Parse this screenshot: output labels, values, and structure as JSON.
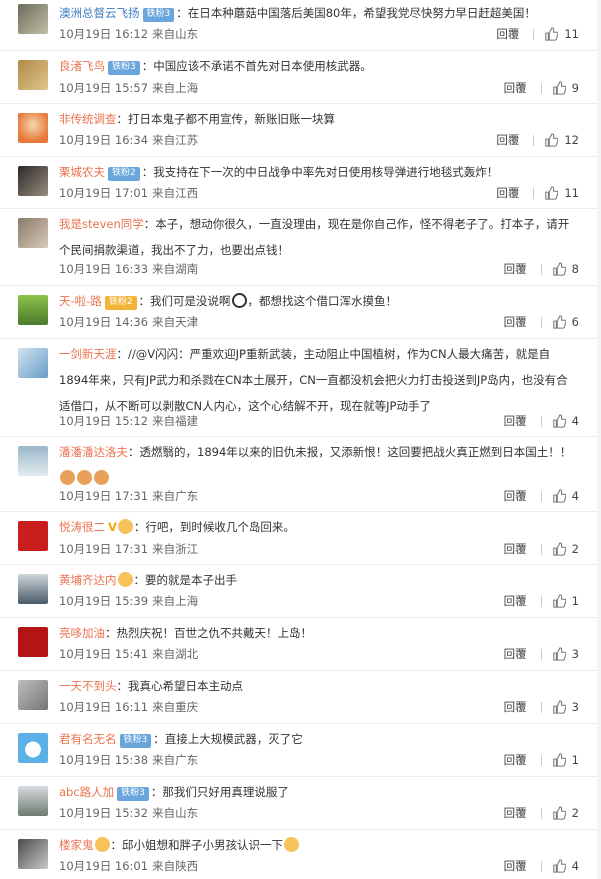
{
  "comments": [
    {
      "user": "澳洲总督云飞扬",
      "badge": "铁粉3",
      "text": "：在日本种蘑菇中国落后美国80年，希望我党尽快努力早日赶超美国！",
      "time": "10月19日 16:12",
      "source": "来自山东",
      "reply": "回覆",
      "likes": "11"
    },
    {
      "user": "良渚飞鸟",
      "badge": "铁粉3",
      "text": "：中国应该不承诺不首先对日本使用核武器。",
      "time": "10月19日 15:57",
      "source": "来自上海",
      "reply": "回覆",
      "likes": "9"
    },
    {
      "user": "非传统调查",
      "text": "：打日本鬼子都不用宣传，新账旧账一块算",
      "time": "10月19日 16:34",
      "source": "来自江苏",
      "reply": "回覆",
      "likes": "12"
    },
    {
      "user": "栗城农夫",
      "badge": "铁粉2",
      "text": "：我支持在下一次的中日战争中率先对日使用核导弹进行地毯式轰炸！",
      "time": "10月19日 17:01",
      "source": "来自江西",
      "reply": "回覆",
      "likes": "11"
    },
    {
      "user": "我是steven同学",
      "text": "：本子，想动你很久，一直没理由，现在是你自己作，怪不得老子了。打本子，请开个民间捐款渠道，我出不了力，也要出点钱！",
      "time": "10月19日 16:33",
      "source": "来自湖南",
      "reply": "回覆",
      "likes": "8"
    },
    {
      "user": "天-啦-路",
      "badge": "铁粉2",
      "text": "：我们可是没说啊",
      "text2": "，都想找这个借口浑水摸鱼！",
      "time": "10月19日 14:36",
      "source": "来自天津",
      "reply": "回覆",
      "likes": "6"
    },
    {
      "user": "一剑新天涯",
      "text": "：//@V闪闪：严重欢迎JP重新武装，主动阻止中国植树，作为CN人最大痛苦，就是自1894年来，只有JP武力和杀戮在CN本土展开，CN一直都没机会把火力打击投送到JP岛内，也没有合适借口，从不断可以剥散CN人内心，这个心结解不开，现在就等JP动手了",
      "time": "10月19日 15:12",
      "source": "来自福建",
      "reply": "回覆",
      "likes": "4"
    },
    {
      "user": "潘潘潘达洛夫",
      "text": "：透燃翳的，1894年以来的旧仇未报，又添新恨！这回要把战火真正燃到日本国土！！",
      "time": "10月19日 17:31",
      "source": "来自广东",
      "reply": "回覆",
      "likes": "4"
    },
    {
      "user": "悦涛很二",
      "text": "：行吧，到时候收几个岛回来。",
      "time": "10月19日 17:31",
      "source": "来自浙江",
      "reply": "回覆",
      "likes": "2"
    },
    {
      "user": "黄埔齐达内",
      "text": "：要的就是本子出手",
      "time": "10月19日 15:39",
      "source": "来自上海",
      "reply": "回覆",
      "likes": "1"
    },
    {
      "user": "亮哆加油",
      "text": "：热烈庆祝！百世之仇不共戴天！上岛！",
      "time": "10月19日 15:41",
      "source": "来自湖北",
      "reply": "回覆",
      "likes": "3"
    },
    {
      "user": "一天不到头",
      "text": "：我真心希望日本主动点",
      "time": "10月19日 16:11",
      "source": "来自重庆",
      "reply": "回覆",
      "likes": "3"
    },
    {
      "user": "君有名无名",
      "badge": "铁粉3",
      "text": "：直接上大规模武器，灭了它",
      "time": "10月19日 15:38",
      "source": "来自广东",
      "reply": "回覆",
      "likes": "1"
    },
    {
      "user": "abc路人加",
      "badge": "铁粉3",
      "text": "：那我们只好用真理说服了",
      "time": "10月19日 15:32",
      "source": "来自山东",
      "reply": "回覆",
      "likes": "2"
    },
    {
      "user": "楼家鬼",
      "text": "：邱小姐想和胖子小男孩认识一下",
      "time": "10月19日 16:01",
      "source": "来自陕西",
      "reply": "回覆",
      "likes": "4"
    }
  ],
  "colors": {
    "username": "#eb7350",
    "badge": "#6aa6dc",
    "meta": "#666666"
  }
}
